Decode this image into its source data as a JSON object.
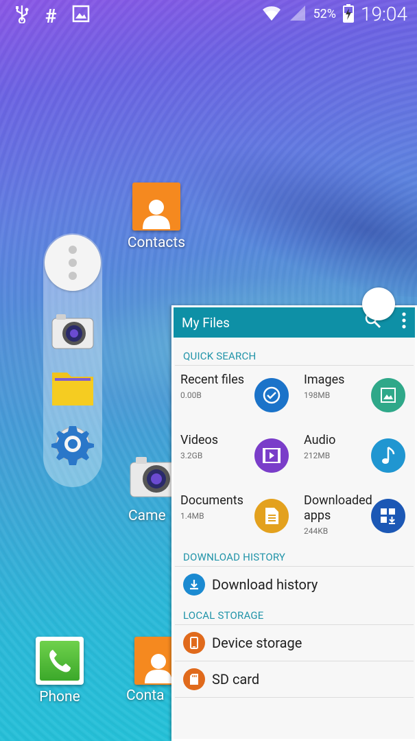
{
  "statusbar": {
    "battery": "52%",
    "time": "19:04"
  },
  "home": {
    "contacts_top": "Contacts",
    "camera": "Came",
    "phone": "Phone",
    "contacts_bottom": "Conta"
  },
  "myfiles": {
    "title": "My Files",
    "quick_search_header": "QUICK SEARCH",
    "categories": [
      {
        "name": "Recent files",
        "size": "0.00B",
        "color": "#1b73c9"
      },
      {
        "name": "Images",
        "size": "198MB",
        "color": "#2fa889"
      },
      {
        "name": "Videos",
        "size": "3.2GB",
        "color": "#7a3dc9"
      },
      {
        "name": "Audio",
        "size": "212MB",
        "color": "#2096d1"
      },
      {
        "name": "Documents",
        "size": "1.4MB",
        "color": "#e3a11e"
      },
      {
        "name": "Downloaded apps",
        "size": "244KB",
        "color": "#1c58b5"
      }
    ],
    "download_history_header": "DOWNLOAD HISTORY",
    "download_history_label": "Download history",
    "local_storage_header": "LOCAL STORAGE",
    "device_storage_label": "Device storage",
    "sd_card_label": "SD card"
  }
}
